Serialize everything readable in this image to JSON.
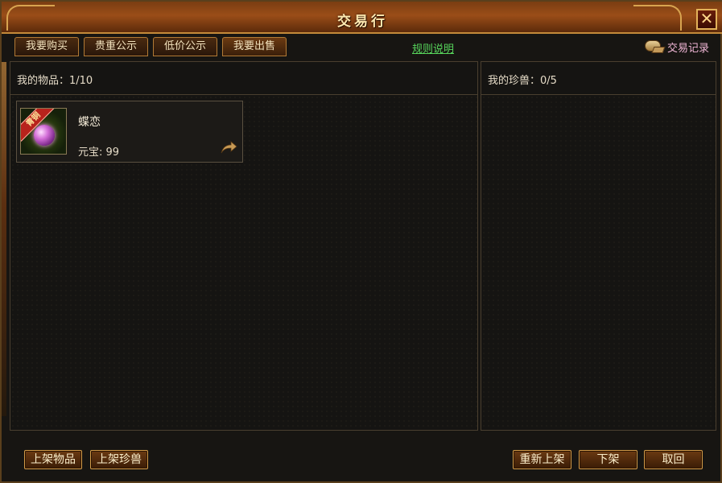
{
  "window": {
    "title": "交易行",
    "close_label": "✕"
  },
  "tabs": [
    {
      "label": "我要购买"
    },
    {
      "label": "贵重公示"
    },
    {
      "label": "低价公示"
    },
    {
      "label": "我要出售"
    }
  ],
  "rules_link": "规则说明",
  "trade_record": "交易记录",
  "left_panel": {
    "header": "我的物品：1/10",
    "items": [
      {
        "name": "蝶恋",
        "price_label": "元宝:",
        "price_value": "99",
        "badge": "青铜",
        "icon": "gem-icon"
      }
    ]
  },
  "right_panel": {
    "header": "我的珍兽：0/5"
  },
  "buttons": {
    "list_item": "上架物品",
    "list_beast": "上架珍兽",
    "relist": "重新上架",
    "unlist": "下架",
    "withdraw": "取回"
  },
  "colors": {
    "accent_gold": "#d29a48",
    "rules_link": "#57d65c",
    "record_text": "#f0b6d6"
  }
}
